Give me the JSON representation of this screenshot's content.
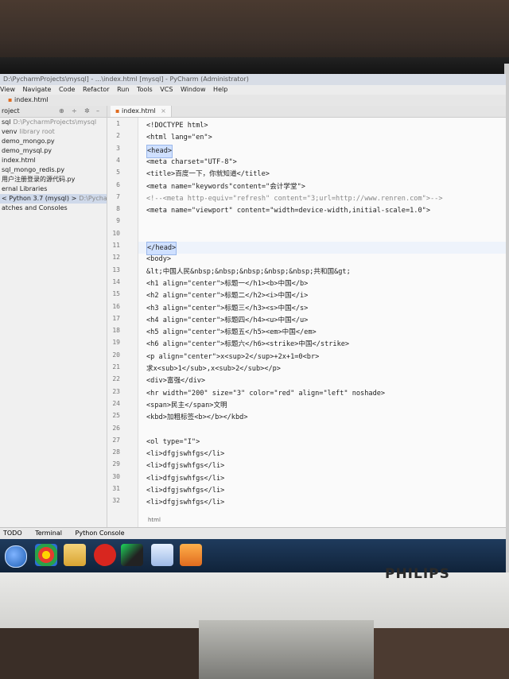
{
  "window": {
    "title": "D:\\PycharmProjects\\mysql] - ...\\index.html [mysql] - PyCharm (Administrator)"
  },
  "menu": [
    "View",
    "Navigate",
    "Code",
    "Refactor",
    "Run",
    "Tools",
    "VCS",
    "Window",
    "Help"
  ],
  "nav": {
    "file": "index.html"
  },
  "project_panel": {
    "header": "roject",
    "items": [
      {
        "text": "sql",
        "dim": "D:\\PycharmProjects\\mysql"
      },
      {
        "text": "venv",
        "dim": "library root"
      },
      {
        "text": "demo_mongo.py",
        "dim": ""
      },
      {
        "text": "demo_mysql.py",
        "dim": ""
      },
      {
        "text": "index.html",
        "dim": ""
      },
      {
        "text": "sql_mongo_redis.py",
        "dim": ""
      },
      {
        "text": "用户注册登录的源代码.py",
        "dim": ""
      },
      {
        "text": "ernal Libraries",
        "dim": ""
      },
      {
        "text": "< Python 3.7 (mysql) >",
        "dim": "D:\\PycharmProje"
      },
      {
        "text": "atches and Consoles",
        "dim": ""
      }
    ]
  },
  "editor": {
    "tab": "index.html",
    "line_numbers": [
      "1",
      "2",
      "3",
      "4",
      "5",
      "6",
      "7",
      "8",
      "9",
      "10",
      "11",
      "12",
      "13",
      "14",
      "15",
      "16",
      "17",
      "18",
      "19",
      "20",
      "21",
      "22",
      "23",
      "24",
      "25",
      "26",
      "27",
      "28",
      "29",
      "30",
      "31",
      "32"
    ],
    "lines": [
      "<!DOCTYPE html>",
      "<html lang=\"en\">",
      "<head>",
      "    <meta charset=\"UTF-8\">",
      "    <title>百度一下，你就知道</title>",
      "    <meta name=\"keywords\"content=\"会计学堂\">",
      "    <!--<meta http-equiv=\"refresh\" content=\"3;url=http://www.renren.com\">-->",
      "    <meta name=\"viewport\" content=\"width=device-width,initial-scale=1.0\">",
      "",
      "",
      "</head>",
      "<body>",
      "&lt;中国人民&nbsp;&nbsp;&nbsp;&nbsp;&nbsp;共和国&gt;",
      "<h1 align=\"center\">标题一</h1><b>中国</b>",
      "<h2 align=\"center\">标题二</h2><i>中国</i>",
      "<h3 align=\"center\">标题三</h3><s>中国</s>",
      "<h4 align=\"center\">标题四</h4><u>中国</u>",
      "<h5 align=\"center\">标题五</h5><em>中国</em>",
      "<h6 align=\"center\">标题六</h6><strike>中国</strike>",
      "<p align=\"center\">x<sup>2</sup>+2x+1=0<br>",
      "    求x<sub>1</sub>,x<sub>2</sub></p>",
      "<div>富强</div>",
      "<hr  width=\"200\"  size=\"3\"  color=\"red\"  align=\"left\"  noshade>",
      "<span>民主</span>文明",
      "<kbd>加粗标签<b></b></kbd>",
      "",
      "<ol type=\"I\">",
      "    <li>dfgjswhfgs</li>",
      "    <li>dfgjswhfgs</li>",
      "    <li>dfgjswhfgs</li>",
      "    <li>dfgjswhfgs</li>",
      "    <li>dfgjswhfgs</li>"
    ],
    "breadcrumb": "html"
  },
  "bottom_tabs": [
    "TODO",
    "Terminal",
    "Python Console"
  ],
  "taskbar": {
    "icons": [
      "start-orb-icon",
      "chrome-icon",
      "file-explorer-icon",
      "netease-music-icon",
      "pycharm-icon",
      "notepad-icon",
      "media-player-icon"
    ]
  },
  "monitor": {
    "brand": "PHILIPS"
  }
}
